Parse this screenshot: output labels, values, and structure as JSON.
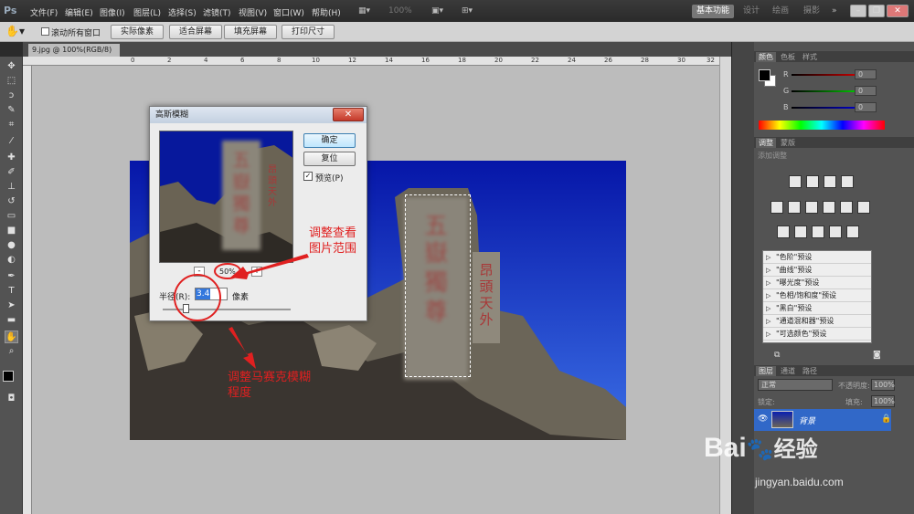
{
  "menubar": {
    "items": [
      "文件(F)",
      "编辑(E)",
      "图像(I)",
      "图层(L)",
      "选择(S)",
      "滤镜(T)",
      "视图(V)",
      "窗口(W)",
      "帮助(H)"
    ],
    "zoom": "100%",
    "workspaces": [
      "基本功能",
      "设计",
      "绘画",
      "摄影"
    ],
    "more": "»"
  },
  "options": {
    "scroll_all": "滚动所有窗口",
    "buttons": [
      "实际像素",
      "适合屏幕",
      "填充屏幕",
      "打印尺寸"
    ]
  },
  "document": {
    "tab_title": "9.jpg @ 100%(RGB/8)",
    "tab_close": "×"
  },
  "ruler_numbers": [
    "0",
    "2",
    "4",
    "6",
    "8",
    "10",
    "12",
    "14",
    "16",
    "18",
    "20",
    "22",
    "24",
    "26",
    "28",
    "30",
    "32"
  ],
  "dialog": {
    "title": "高斯模糊",
    "ok": "确定",
    "reset": "复位",
    "preview_label": "预览(P)",
    "preview_checked": true,
    "zoom_value": "50%",
    "zoom_minus": "-",
    "zoom_plus": "+",
    "radius_label": "半径(R):",
    "radius_value": "3.4",
    "radius_unit": "像素",
    "radius_slider": 0.18
  },
  "panels": {
    "color_tabs": [
      "颜色",
      "色板",
      "样式"
    ],
    "rgb": [
      {
        "label": "R",
        "value": "0"
      },
      {
        "label": "G",
        "value": "0"
      },
      {
        "label": "B",
        "value": "0"
      }
    ],
    "adjust_tabs": [
      "调整",
      "蒙版"
    ],
    "adjust_title": "添加调整",
    "presets": [
      "\"色阶\"预设",
      "\"曲线\"预设",
      "\"曝光度\"预设",
      "\"色相/饱和度\"预设",
      "\"黑白\"预设",
      "\"通道混和器\"预设",
      "\"可选颜色\"预设"
    ],
    "layer_tabs": [
      "图层",
      "通道",
      "路径"
    ],
    "blend_mode": "正常",
    "opacity_label": "不透明度:",
    "opacity": "100%",
    "lock_label": "锁定:",
    "fill_label": "填充:",
    "fill": "100%",
    "layer_name": "背景"
  },
  "annotations": {
    "range": [
      "调整查看",
      "图片范围"
    ],
    "mosaic": [
      "调整马赛克模糊",
      "程度"
    ]
  },
  "watermark": {
    "brand": "Bai",
    "brand2": "经验",
    "url": "jingyan.baidu.com"
  },
  "colors": {
    "accent": "#e02020",
    "sky": "#0a1fb0",
    "dialog_title": "#c3d0e0"
  }
}
